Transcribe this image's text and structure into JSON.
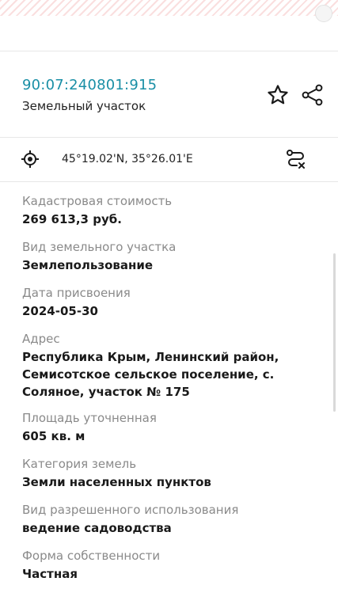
{
  "header": {
    "cadastral_number": "90:07:240801:915",
    "object_type": "Земельный участок"
  },
  "location": {
    "coordinates": "45°19.02'N, 35°26.01'E"
  },
  "fields": [
    {
      "label": "Кадастровая стоимость",
      "value": "269 613,3 руб."
    },
    {
      "label": "Вид земельного участка",
      "value": "Землепользование"
    },
    {
      "label": "Дата присвоения",
      "value": "2024-05-30"
    },
    {
      "label": "Адрес",
      "value": "Республика Крым, Ленинский район, Семисотское сельское поселение, с. Соляное, участок № 175"
    },
    {
      "label": "Площадь уточненная",
      "value": "605 кв. м"
    },
    {
      "label": "Категория земель",
      "value": "Земли населенных пунктов"
    },
    {
      "label": "Вид разрешенного использования",
      "value": "ведение садоводства"
    },
    {
      "label": "Форма собственности",
      "value": "Частная"
    }
  ],
  "icons": {
    "favorite": "star-icon",
    "share": "share-icon",
    "locate": "target-icon",
    "route": "route-icon"
  },
  "colors": {
    "accent": "#1a8fa6",
    "label": "#8a8a8a",
    "text": "#1a1a1a"
  }
}
